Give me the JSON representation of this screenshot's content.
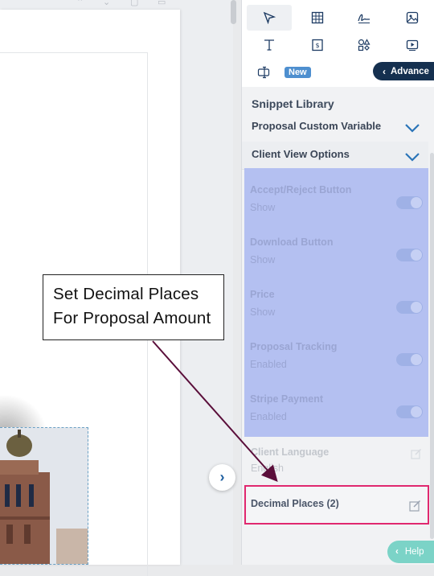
{
  "callout": {
    "line1": "Set Decimal Places",
    "line2": "For Proposal Amount"
  },
  "toolbar": {
    "tools": [
      {
        "icon": "cursor-icon"
      },
      {
        "icon": "table-icon"
      },
      {
        "icon": "signature-icon"
      },
      {
        "icon": "image-icon"
      },
      {
        "icon": "text-icon"
      },
      {
        "icon": "pricing-icon"
      },
      {
        "icon": "shapes-icon"
      },
      {
        "icon": "video-icon"
      },
      {
        "icon": "text-field-icon"
      }
    ],
    "new_badge": "New",
    "advance_label": "Advance"
  },
  "snippet_library": {
    "title": "Snippet Library",
    "sections": [
      {
        "label": "Proposal Custom Variable"
      },
      {
        "label": "Client View Options"
      }
    ]
  },
  "client_view_options": [
    {
      "name": "Accept/Reject Button",
      "value": "Show",
      "enabled": true
    },
    {
      "name": "Download Button",
      "value": "Show",
      "enabled": true
    },
    {
      "name": "Price",
      "value": "Show",
      "enabled": true
    },
    {
      "name": "Proposal Tracking",
      "value": "Enabled",
      "enabled": true
    },
    {
      "name": "Stripe Payment",
      "value": "Enabled",
      "enabled": true
    }
  ],
  "client_language": {
    "name": "Client Language",
    "value": "English"
  },
  "decimal_places": {
    "label": "Decimal Places (2)"
  },
  "help": {
    "label": "Help"
  },
  "colors": {
    "highlight_overlay": "#b4c0f1",
    "highlight_border": "#e0286f",
    "advance_bg": "#15304f",
    "help_bg": "#7bd3c7",
    "arrow": "#5a0e3a"
  }
}
